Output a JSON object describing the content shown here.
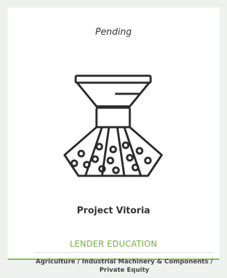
{
  "card": {
    "status": "Pending",
    "icon": "spray-nozzle-icon",
    "title": "Project Vitoria",
    "category": "LENDER EDUCATION",
    "industries": "Agriculture / Industrial Machinery & Components / Private Equity",
    "accent_color": "#7cc04b"
  }
}
